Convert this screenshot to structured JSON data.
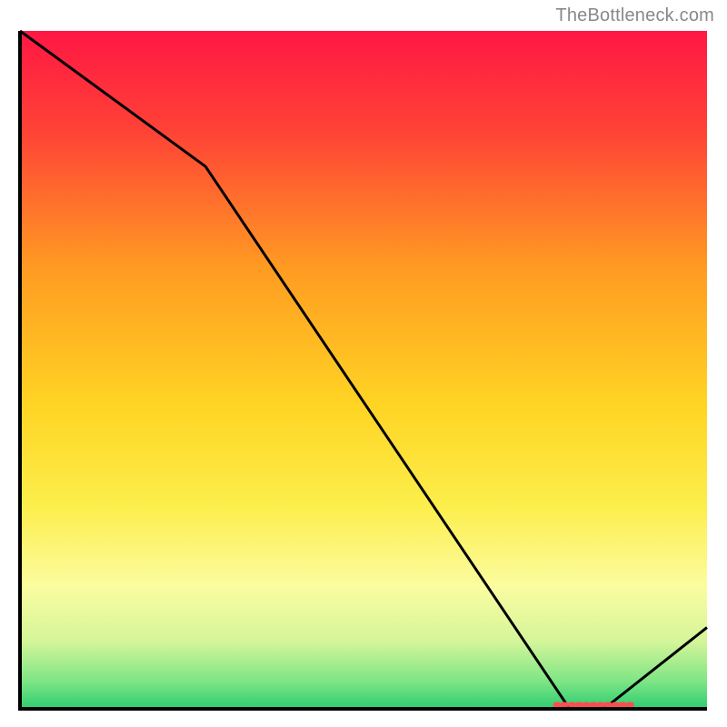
{
  "watermark": "TheBottleneck.com",
  "chart_data": {
    "type": "line",
    "title": "",
    "xlabel": "",
    "ylabel": "",
    "xlim": [
      0,
      100
    ],
    "ylim": [
      0,
      100
    ],
    "gradient_stops": [
      {
        "offset": 0,
        "color": "#ff1744"
      },
      {
        "offset": 15,
        "color": "#ff4336"
      },
      {
        "offset": 35,
        "color": "#ff9b22"
      },
      {
        "offset": 55,
        "color": "#ffd423"
      },
      {
        "offset": 70,
        "color": "#fcee4b"
      },
      {
        "offset": 82,
        "color": "#fbfca0"
      },
      {
        "offset": 90,
        "color": "#d5f59a"
      },
      {
        "offset": 96,
        "color": "#7de585"
      },
      {
        "offset": 100,
        "color": "#2ecc71"
      }
    ],
    "line": {
      "x": [
        0,
        27,
        80,
        85,
        100
      ],
      "y": [
        100,
        80,
        0,
        0,
        12
      ]
    },
    "highlight_segment": {
      "x_start": 78,
      "x_end": 89,
      "y": 0.6,
      "color": "#ff4d4d"
    },
    "axis": {
      "color": "#000000",
      "width": 4
    }
  }
}
